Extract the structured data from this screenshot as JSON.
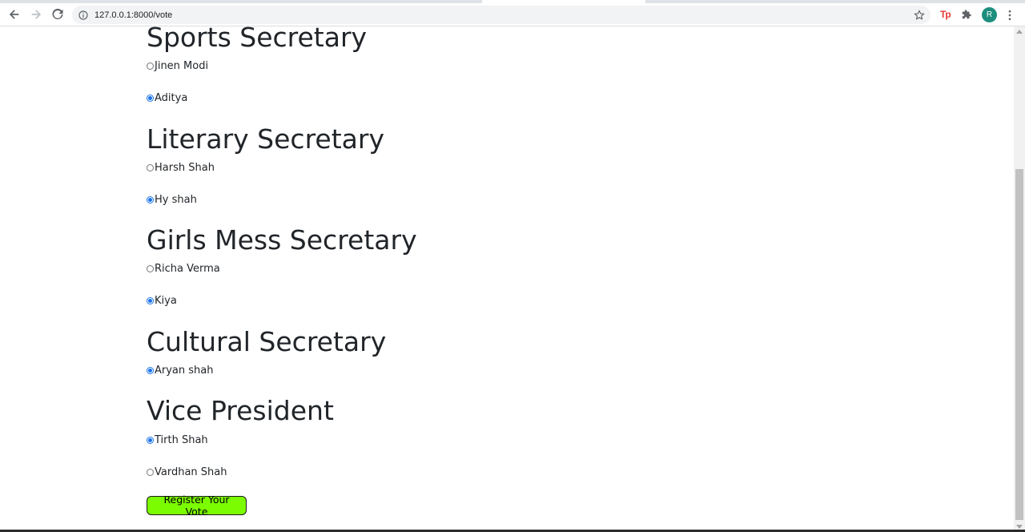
{
  "browser": {
    "url": "127.0.0.1:8000/vote",
    "extension_label": "Tp",
    "avatar_letter": "R",
    "icons": [
      "back-icon",
      "forward-icon",
      "reload-icon",
      "info-icon",
      "star-icon",
      "puzzle-icon",
      "menu-dots-icon"
    ]
  },
  "sections": [
    {
      "title": "Sports Secretary",
      "options": [
        {
          "label": "Jinen Modi",
          "checked": false
        },
        {
          "label": "Aditya",
          "checked": true
        }
      ]
    },
    {
      "title": "Literary Secretary",
      "options": [
        {
          "label": "Harsh Shah",
          "checked": false
        },
        {
          "label": "Hy shah",
          "checked": true
        }
      ]
    },
    {
      "title": "Girls Mess Secretary",
      "options": [
        {
          "label": "Richa Verma",
          "checked": false
        },
        {
          "label": "Kiya",
          "checked": true
        }
      ]
    },
    {
      "title": "Cultural Secretary",
      "options": [
        {
          "label": "Aryan shah",
          "checked": true
        }
      ]
    },
    {
      "title": "Vice President",
      "options": [
        {
          "label": "Tirth Shah",
          "checked": true
        },
        {
          "label": "Vardhan Shah",
          "checked": false
        }
      ]
    }
  ],
  "submit": {
    "label": "Register Your Vote"
  },
  "colors": {
    "accent": "#1a73e8",
    "submit_bg": "#7cfc00",
    "avatar_bg": "#1e8e7e"
  }
}
